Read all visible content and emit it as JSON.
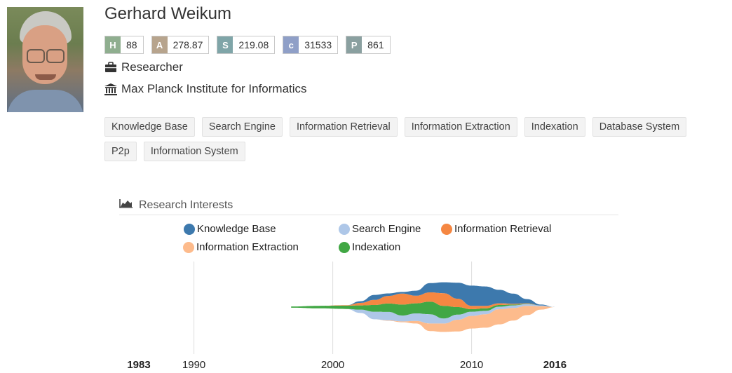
{
  "profile": {
    "name": "Gerhard Weikum",
    "role": "Researcher",
    "affiliation": "Max Planck Institute for Informatics",
    "badges": [
      {
        "key": "H",
        "value": "88",
        "color": "#8fae8f"
      },
      {
        "key": "A",
        "value": "278.87",
        "color": "#b7a48d"
      },
      {
        "key": "S",
        "value": "219.08",
        "color": "#7fa5a8"
      },
      {
        "key": "c",
        "value": "31533",
        "color": "#8f9fc7"
      },
      {
        "key": "P",
        "value": "861",
        "color": "#8aa0a0"
      }
    ]
  },
  "icons": {
    "role": "briefcase-icon",
    "affiliation": "institution-icon",
    "research": "area-chart-icon"
  },
  "tags": [
    "Knowledge Base",
    "Search Engine",
    "Information Retrieval",
    "Information Extraction",
    "Indexation",
    "Database System",
    "P2p",
    "Information System"
  ],
  "research": {
    "title": "Research Interests"
  },
  "chart_data": {
    "type": "area",
    "x": [
      1997,
      1999,
      2001,
      2002,
      2003,
      2004,
      2005,
      2006,
      2007,
      2008,
      2009,
      2010,
      2011,
      2012,
      2013,
      2014,
      2015,
      2016
    ],
    "series": [
      {
        "name": "Knowledge Base",
        "color": "#3d79ad",
        "values": [
          0,
          0,
          0,
          0.2,
          0.6,
          0.3,
          0.2,
          0.6,
          1.1,
          1.3,
          1.9,
          2.4,
          2.3,
          1.6,
          1.2,
          0.5,
          0.1,
          0
        ]
      },
      {
        "name": "Search Engine",
        "color": "#aec7e8",
        "values": [
          0,
          0,
          0,
          0.4,
          0.9,
          1.0,
          0.7,
          0.9,
          1.1,
          0.6,
          0.6,
          0.5,
          0.4,
          0.3,
          0.3,
          0.2,
          0.1,
          0
        ]
      },
      {
        "name": "Information Retrieval",
        "color": "#f58742",
        "values": [
          0,
          0,
          0.05,
          0.3,
          0.6,
          0.9,
          1.3,
          0.9,
          1.1,
          1.5,
          1.0,
          0.4,
          0.3,
          0.2,
          0.1,
          0.05,
          0,
          0
        ]
      },
      {
        "name": "Information Extraction",
        "color": "#fdbb8c",
        "values": [
          0,
          0,
          0,
          0,
          0,
          0.05,
          0.1,
          0.3,
          0.9,
          1.0,
          1.4,
          1.5,
          1.6,
          1.8,
          1.5,
          1.1,
          0.4,
          0
        ]
      },
      {
        "name": "Indexation",
        "color": "#41a744",
        "values": [
          0.15,
          0.3,
          0.4,
          0.5,
          0.8,
          1.0,
          1.3,
          1.2,
          1.5,
          1.5,
          0.9,
          0.3,
          0.3,
          0.2,
          0.1,
          0.05,
          0,
          0
        ]
      }
    ],
    "xlim": [
      1983,
      2016
    ],
    "tick_labels": [
      "1983",
      "1990",
      "2000",
      "2010",
      "2016"
    ],
    "tick_values": [
      1983,
      1990,
      2000,
      2010,
      2016
    ],
    "tick_bold": [
      true,
      false,
      false,
      false,
      true
    ],
    "legend_placement": "top",
    "grid": true
  }
}
